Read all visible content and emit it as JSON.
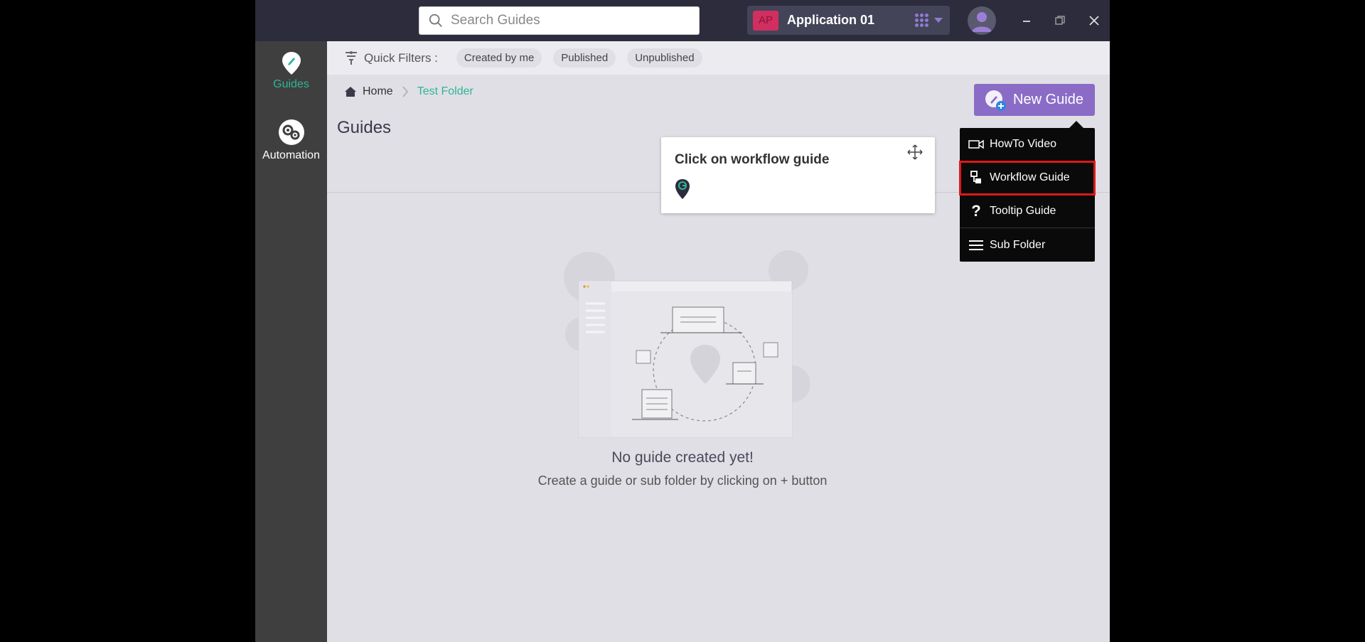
{
  "search": {
    "placeholder": "Search Guides"
  },
  "app_selector": {
    "badge": "AP",
    "name": "Application 01"
  },
  "sidebar": {
    "items": [
      {
        "label": "Guides",
        "active": true
      },
      {
        "label": "Automation",
        "active": false
      }
    ]
  },
  "filters": {
    "label": "Quick Filters :",
    "chips": [
      "Created by me",
      "Published",
      "Unpublished"
    ]
  },
  "breadcrumb": {
    "home": "Home",
    "current": "Test Folder"
  },
  "page": {
    "title": "Guides"
  },
  "new_guide": {
    "label": "New Guide"
  },
  "menu": {
    "items": [
      {
        "label": "HowTo Video",
        "icon": "video-icon"
      },
      {
        "label": "Workflow Guide",
        "icon": "workflow-icon",
        "highlighted": true
      },
      {
        "label": "Tooltip Guide",
        "icon": "question-icon"
      },
      {
        "label": "Sub Folder",
        "icon": "menu-lines-icon"
      }
    ]
  },
  "tooltip": {
    "text": "Click on workflow guide"
  },
  "empty_state": {
    "title": "No guide created yet!",
    "subtitle": "Create a guide or sub folder by clicking on + button"
  },
  "colors": {
    "accent": "#8a6cc7",
    "active_green": "#2fb598",
    "badge": "#d12e61",
    "highlight": "#e01818"
  }
}
